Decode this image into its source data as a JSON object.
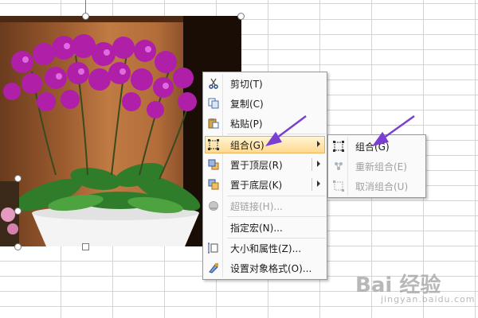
{
  "context_menu": {
    "items": [
      {
        "label": "剪切(T)",
        "icon": "scissors-icon",
        "disabled": false
      },
      {
        "label": "复制(C)",
        "icon": "copy-icon",
        "disabled": false
      },
      {
        "label": "粘贴(P)",
        "icon": "paste-icon",
        "disabled": false
      },
      {
        "label": "组合(G)",
        "icon": "group-icon",
        "disabled": false,
        "active": true,
        "has_submenu": true
      },
      {
        "label": "置于顶层(R)",
        "icon": "bring-to-front-icon",
        "disabled": false,
        "has_submenu": true
      },
      {
        "label": "置于底层(K)",
        "icon": "send-to-back-icon",
        "disabled": false,
        "has_submenu": true
      },
      {
        "label": "超链接(H)...",
        "icon": "hyperlink-icon",
        "disabled": true
      },
      {
        "label": "指定宏(N)...",
        "icon": "",
        "disabled": false
      },
      {
        "label": "大小和属性(Z)...",
        "icon": "size-properties-icon",
        "disabled": false
      },
      {
        "label": "设置对象格式(O)...",
        "icon": "format-object-icon",
        "disabled": false
      }
    ]
  },
  "submenu": {
    "items": [
      {
        "label": "组合(G)",
        "icon": "group-icon",
        "disabled": false
      },
      {
        "label": "重新组合(E)",
        "icon": "regroup-icon",
        "disabled": true
      },
      {
        "label": "取消组合(U)",
        "icon": "ungroup-icon",
        "disabled": true
      }
    ]
  },
  "watermark": {
    "main": "Bai 经验",
    "sub": "jingyan.baidu.com"
  },
  "colors": {
    "menu_highlight": "#ffd78a",
    "annotation_arrow": "#7a3fd0"
  }
}
